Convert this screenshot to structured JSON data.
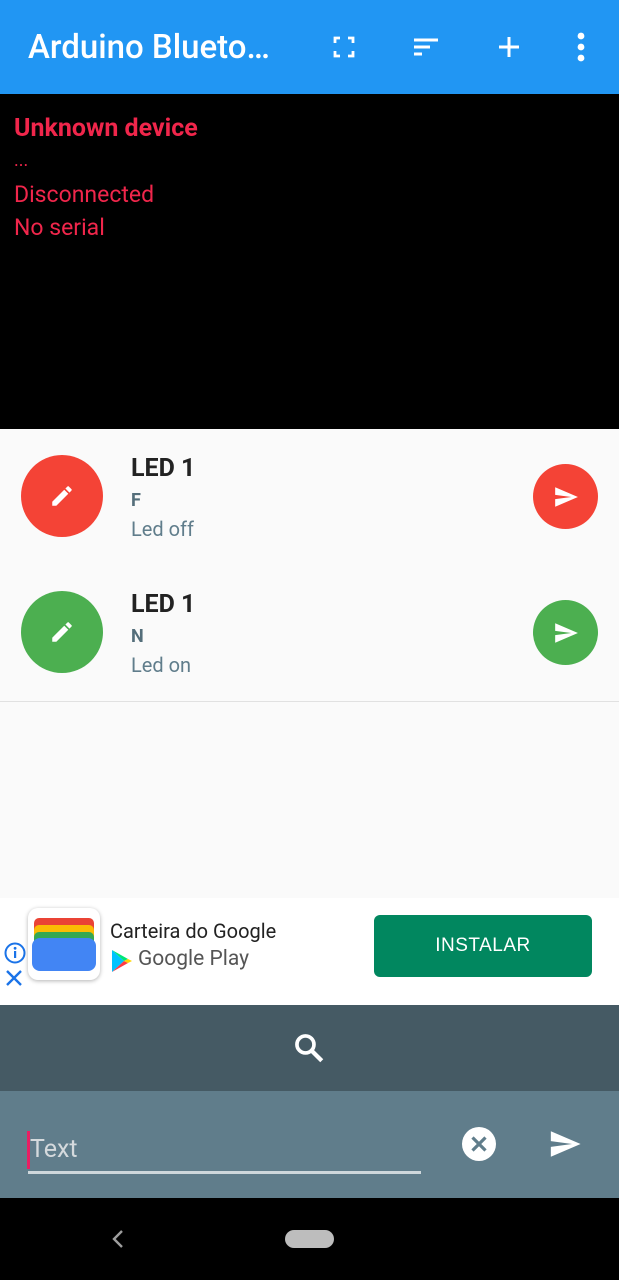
{
  "appbar": {
    "title": "Arduino Blueto…",
    "actions": [
      "fullscreen-icon",
      "sort-icon",
      "add-icon",
      "more-vert-icon"
    ]
  },
  "console": {
    "device": "Unknown device",
    "dots": "...",
    "status": "Disconnected",
    "serial": "No serial"
  },
  "commands": [
    {
      "name": "LED 1",
      "cmd": "F",
      "desc": "Led off",
      "color": "#f44336"
    },
    {
      "name": "LED 1",
      "cmd": "N",
      "desc": "Led on",
      "color": "#4caf50"
    }
  ],
  "ad": {
    "app_name": "Carteira do Google",
    "store": "Google Play",
    "install": "INSTALAR"
  },
  "input": {
    "placeholder": "Text",
    "value": ""
  },
  "colors": {
    "appbar": "#2196f3",
    "console_text": "#f0264b",
    "search_bar": "#455a64",
    "input_bar": "#607d8b",
    "install": "#01875f"
  }
}
